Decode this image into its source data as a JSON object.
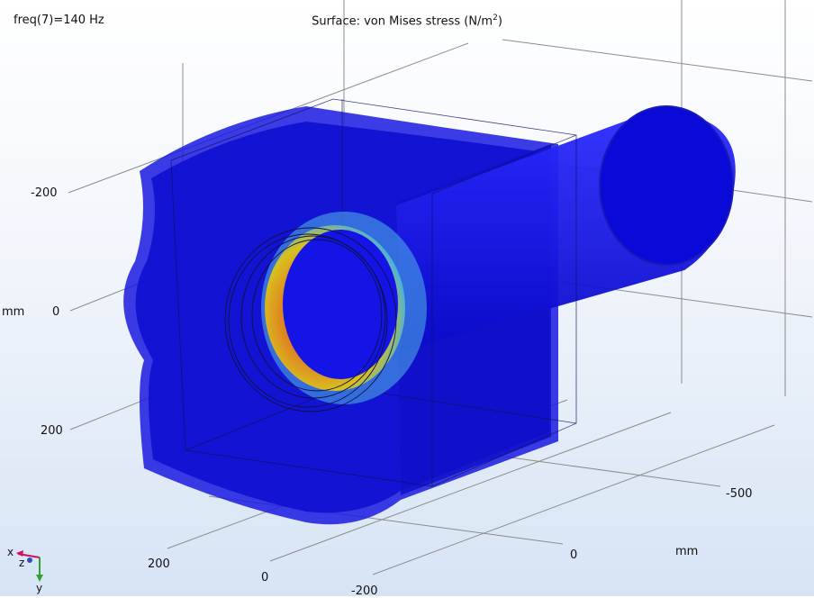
{
  "header": {
    "freq_label": "freq(7)=140 Hz",
    "title_prefix": "Surface: von Mises stress (N/m",
    "title_sup": "2",
    "title_suffix": ")"
  },
  "axes": {
    "vertical_ticks": [
      "-200",
      "0",
      "200"
    ],
    "vertical_unit": "mm",
    "right_ticks": [
      "-500"
    ],
    "right_unit": "mm",
    "front_ticks": [
      "0"
    ],
    "bottom_ticks": [
      "200",
      "0",
      "-200"
    ]
  },
  "triad": {
    "x": "x",
    "y": "y",
    "z": "z"
  },
  "colors": {
    "body": "#1515e8",
    "body_dark": "#0b0bb8",
    "stress_high": "#d8401a",
    "stress_mid": "#d8c020",
    "stress_low": "#40b0e8",
    "grid": "#8c8c8c",
    "x_axis": "#d01060",
    "y_axis": "#30a030",
    "z_axis": "#3050c0"
  }
}
